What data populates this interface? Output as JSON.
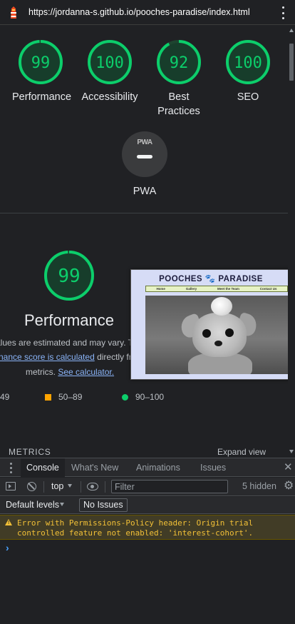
{
  "browser": {
    "url": "https://jordanna-s.github.io/pooches-paradise/index.html"
  },
  "scores": [
    {
      "value": "99",
      "label": "Performance",
      "fraction": 0.99
    },
    {
      "value": "100",
      "label": "Accessibility",
      "fraction": 1.0
    },
    {
      "value": "92",
      "label_line1": "Best",
      "label_line2": "Practices",
      "fraction": 0.92
    },
    {
      "value": "100",
      "label": "SEO",
      "fraction": 1.0
    }
  ],
  "pwa": {
    "badge": "PWA",
    "label": "PWA"
  },
  "performance": {
    "score": "99",
    "fraction": 0.99,
    "title": "Performance",
    "desc_line1": "alues are estimated and may vary. T",
    "desc_link1": "nance score is calculated",
    "desc_line2_tail": " directly fro",
    "desc_line3_head": "metrics. ",
    "desc_link2": "See calculator.",
    "legend": {
      "fail": "49",
      "average": "50–89",
      "pass": "90–100"
    },
    "metrics_label": "METRICS",
    "expand_label": "Expand view"
  },
  "preview": {
    "site_title": "POOCHES 🐾 PARADISE",
    "nav": [
      "Home",
      "Gallery",
      "Meet the Team",
      "Contact Us"
    ]
  },
  "devtools": {
    "tabs": [
      "Console",
      "What's New",
      "Animations",
      "Issues"
    ],
    "active_tab": "Console",
    "context": "top",
    "filter_placeholder": "Filter",
    "hidden_count": "5 hidden",
    "levels": "Default levels",
    "issues": "No Issues",
    "warning": "Error with Permissions-Policy header: Origin trial\ncontrolled feature not enabled: 'interest-cohort'.",
    "prompt": "›"
  },
  "colors": {
    "pass": "#0cce6b",
    "average": "#ffa400",
    "link": "#8ab4f8",
    "warning_text": "#f2c037",
    "warning_bg": "#413c26"
  }
}
